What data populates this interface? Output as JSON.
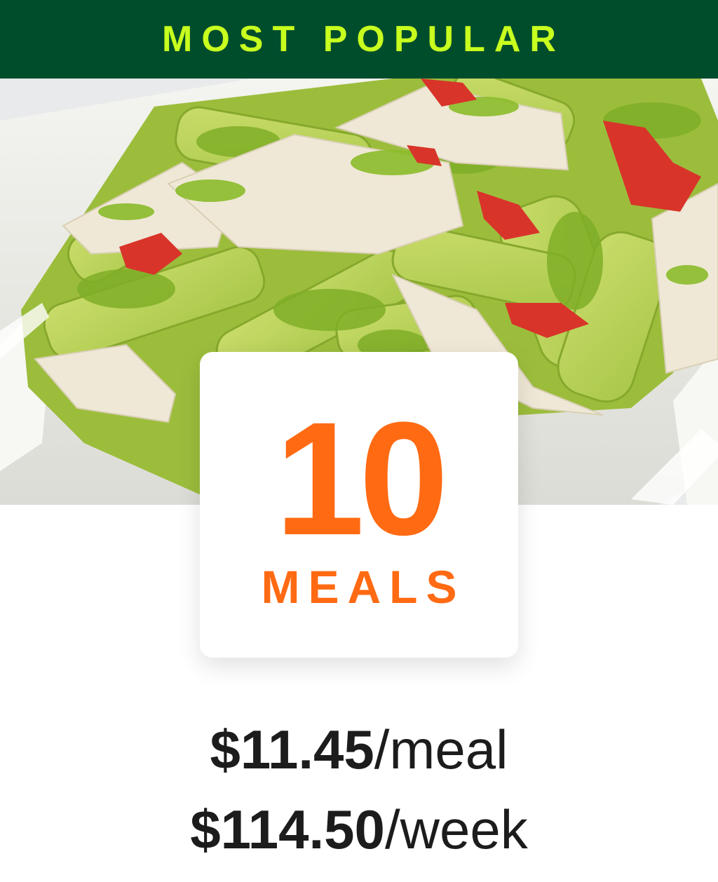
{
  "banner": {
    "text": "MOST POPULAR",
    "background": "#004d2c",
    "text_color": "#c8ff1e"
  },
  "hero_image": {
    "description_icon": "pesto-pasta-photo"
  },
  "plan": {
    "count": "10",
    "unit": "MEALS",
    "accent": "#ff6a13"
  },
  "pricing": {
    "per_meal": {
      "amount": "$11.45",
      "unit": "/meal"
    },
    "per_week": {
      "amount": "$114.50",
      "unit": "/week"
    }
  }
}
